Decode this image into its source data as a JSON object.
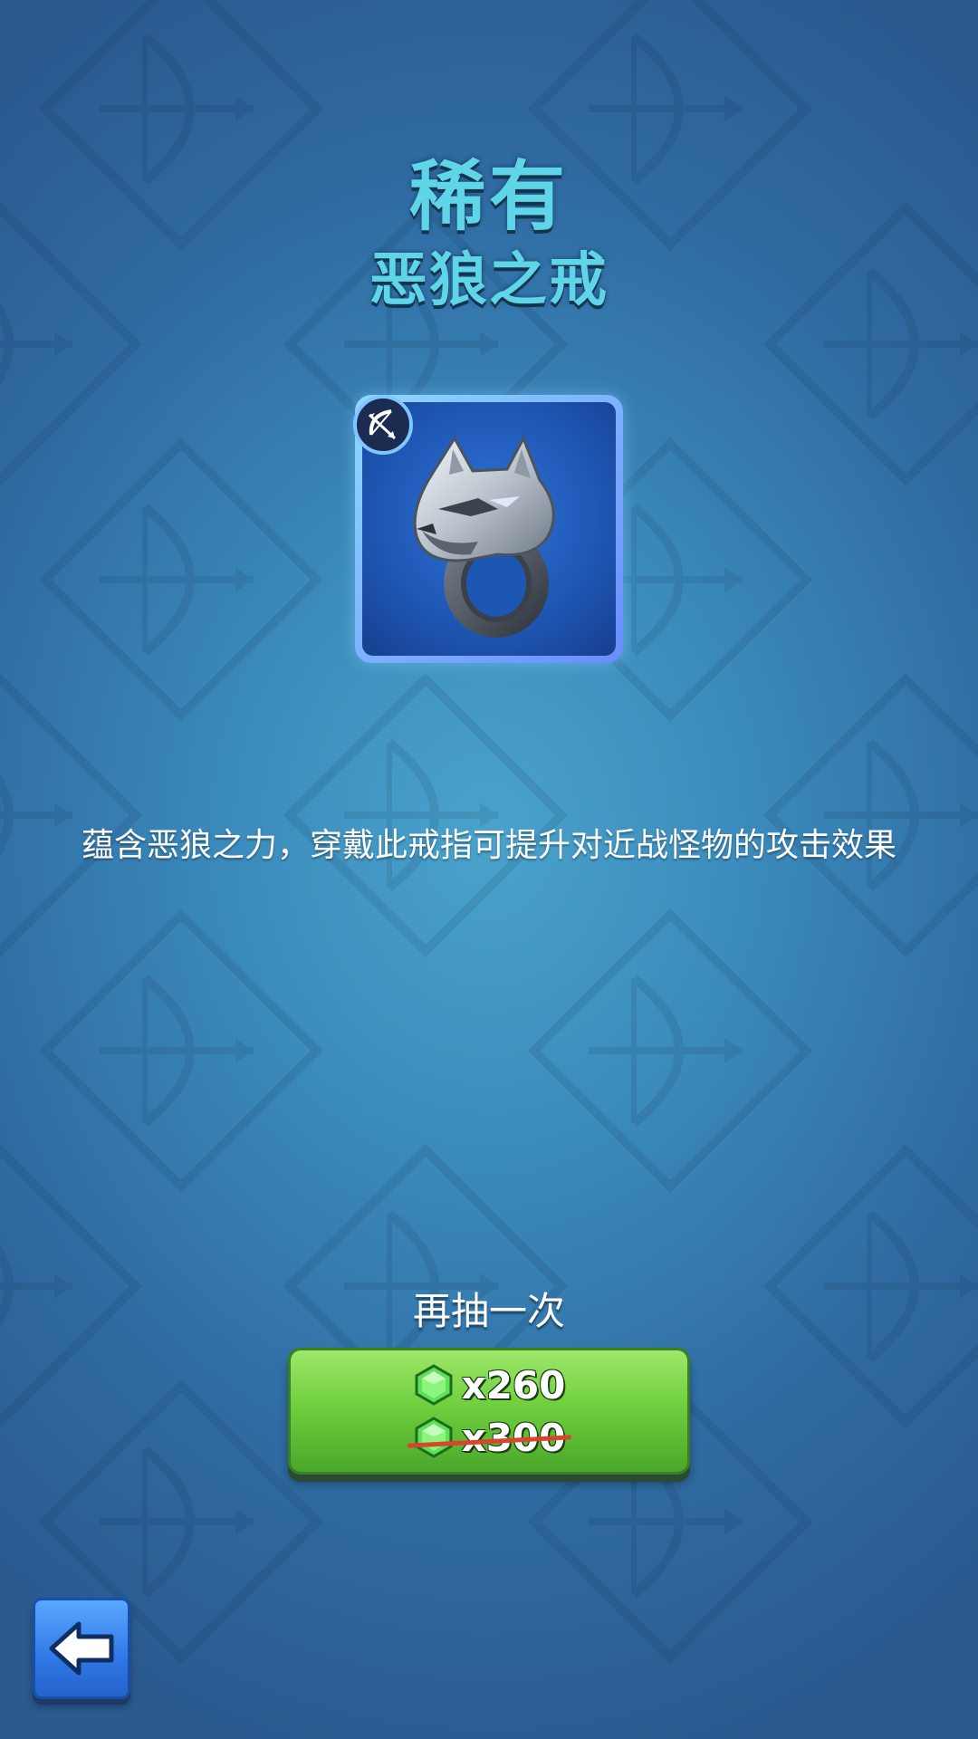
{
  "header": {
    "rarity": "稀有",
    "item_name": "恶狼之戒"
  },
  "item": {
    "icon": "wolf-ring-icon",
    "type_badge_icon": "bow-icon",
    "description": "蕴含恶狼之力，穿戴此戒指可提升对近战怪物的攻击效果"
  },
  "reroll": {
    "label": "再抽一次",
    "current_price": "x260",
    "original_price": "x300",
    "currency_icon": "gem-icon"
  },
  "navigation": {
    "back_icon": "back-arrow-icon"
  },
  "colors": {
    "title": "#5fd6e8",
    "button_green": "#6fcf3e",
    "back_blue": "#2f78e6",
    "gem_green": "#5fe05a",
    "strike_red": "#d8452c"
  }
}
